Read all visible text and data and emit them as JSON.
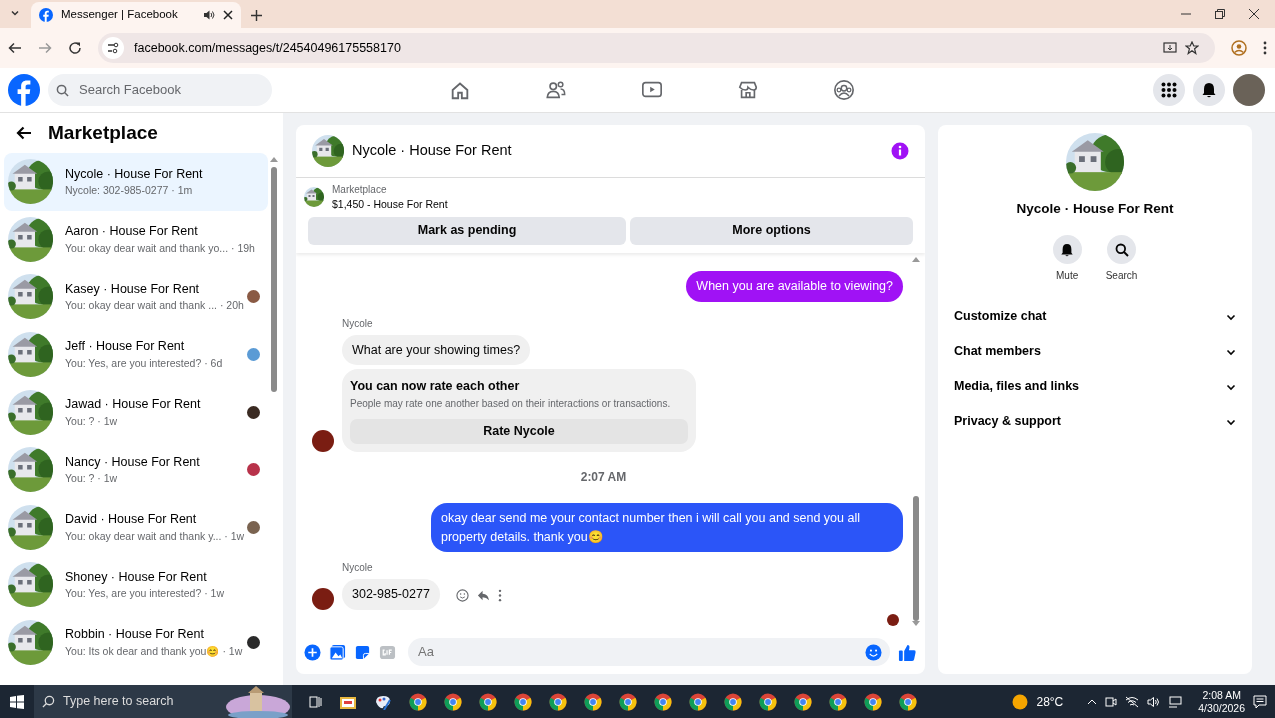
{
  "browser": {
    "tab_title": "Messenger | Facebook",
    "url": "facebook.com/messages/t/24540496175558170"
  },
  "header": {
    "search_placeholder": "Search Facebook"
  },
  "sidebar": {
    "title": "Marketplace",
    "conversations": [
      {
        "name": "Nycole · House For Rent",
        "preview": "Nycole: 302-985-0277",
        "time": "· 1m",
        "selected": true
      },
      {
        "name": "Aaron · House For Rent",
        "preview": "You: okay dear wait and thank yo...",
        "time": "· 19h",
        "selected": false
      },
      {
        "name": "Kasey · House For Rent",
        "preview": "You: okay dear wait and thank ...",
        "time": "· 20h",
        "selected": false,
        "color": "#8a5a44"
      },
      {
        "name": "Jeff · House For Rent",
        "preview": "You: Yes, are you interested?",
        "time": "· 6d",
        "selected": false,
        "color": "#5b9bd5"
      },
      {
        "name": "Jawad · House For Rent",
        "preview": "You: ?",
        "time": "· 1w",
        "selected": false,
        "color": "#3a2a22"
      },
      {
        "name": "Nancy · House For Rent",
        "preview": "You: ?",
        "time": "· 1w",
        "selected": false,
        "color": "#b8324a"
      },
      {
        "name": "David · House For Rent",
        "preview": "You: okay dear wait and thank y...",
        "time": "· 1w",
        "selected": false,
        "color": "#7a6350"
      },
      {
        "name": "Shoney · House For Rent",
        "preview": "You: Yes, are you interested?",
        "time": "· 1w",
        "selected": false
      },
      {
        "name": "Robbin · House For Rent",
        "preview": "You: Its ok dear and thank you😊",
        "time": "· 1w",
        "selected": false,
        "color": "#2a2a2a"
      }
    ]
  },
  "chat": {
    "title": "Nycole · House For Rent",
    "listing": {
      "source": "Marketplace",
      "title": "$1,450 - House For Rent"
    },
    "actions": [
      "Mark as pending",
      "More options"
    ],
    "messages": [
      {
        "kind": "outgoing",
        "text": "When you are available to viewing?",
        "color": "#a012f5"
      },
      {
        "kind": "sender",
        "text": "Nycole"
      },
      {
        "kind": "incoming",
        "text": "What are your showing times?",
        "avatar": false
      },
      {
        "kind": "rating",
        "title": "You can now rate each other",
        "body": "People may rate one another based on their interactions or transactions.",
        "button": "Rate Nycole",
        "avatar": true
      },
      {
        "kind": "timestamp",
        "text": "2:07 AM"
      },
      {
        "kind": "outgoing",
        "text": "okay dear send me your contact number then i will call you and send you all property details. thank you😊",
        "color": "#2b55f8"
      },
      {
        "kind": "sender",
        "text": "Nycole"
      },
      {
        "kind": "incoming",
        "text": "302-985-0277",
        "avatar": true
      },
      {
        "kind": "seen"
      }
    ],
    "composer": {
      "placeholder": "Aa"
    }
  },
  "details": {
    "title": "Nycole · House For Rent",
    "actions": [
      {
        "kind": "mute",
        "label": "Mute"
      },
      {
        "kind": "search",
        "label": "Search"
      }
    ],
    "sections": [
      {
        "label": "Customize chat",
        "expanded": false
      },
      {
        "label": "Chat members",
        "expanded": false
      },
      {
        "label": "Media, files and links",
        "expanded": false
      },
      {
        "label": "Privacy & support",
        "expanded": false
      }
    ]
  },
  "taskbar": {
    "search_placeholder": "Type here to search",
    "weather": "28°C",
    "time": "2:08 AM",
    "date": "4/30/2026"
  }
}
